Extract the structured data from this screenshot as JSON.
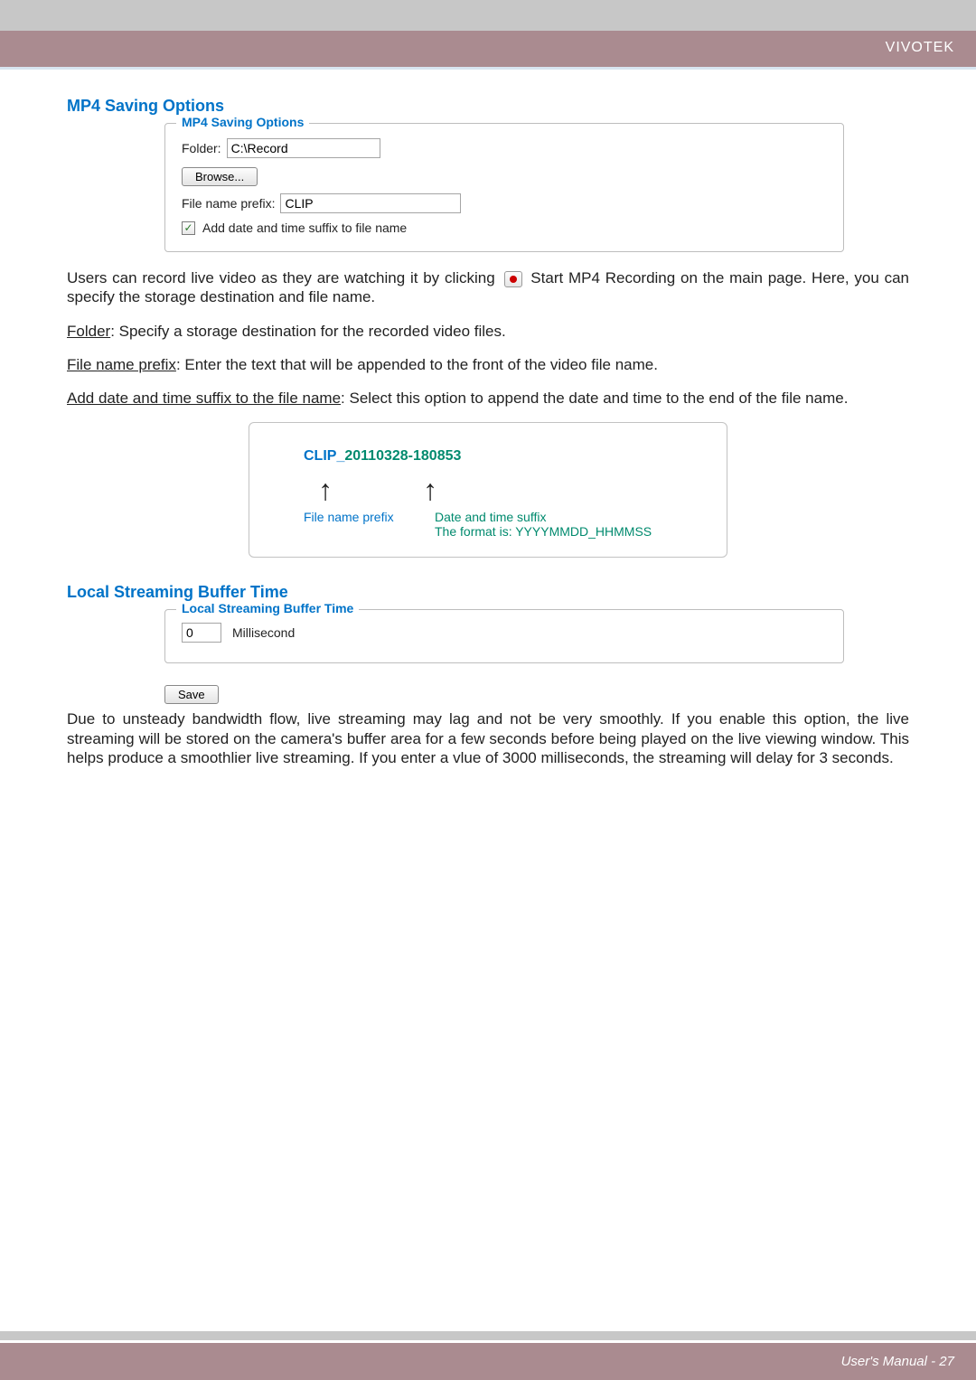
{
  "header": {
    "brand": "VIVOTEK"
  },
  "section1": {
    "title": "MP4 Saving Options",
    "legend": "MP4 Saving Options",
    "folder_label": "Folder:",
    "folder_value": "C:\\Record",
    "browse_label": "Browse...",
    "prefix_label": "File name prefix:",
    "prefix_value": "CLIP",
    "suffix_checkbox_label": "Add date and time suffix to file name"
  },
  "para1a": "Users can record live video as they are watching it by clicking ",
  "para1b": " Start MP4 Recording on the main page. Here, you can specify the storage destination and file name.",
  "para2_u": "Folder",
  "para2": ": Specify a storage destination for the recorded video files.",
  "para3_u": "File name prefix",
  "para3": ": Enter the text that will be appended to the front of the video file name.",
  "para4_u": "Add date and time suffix to the file name",
  "para4": ": Select this option to append the date and time to the end of the file name.",
  "example": {
    "prefix": "CLIP",
    "underscore": "_",
    "suffix": "20110328-180853",
    "label_prefix": "File name prefix",
    "label_suffix_line1": "Date and time suffix",
    "label_suffix_line2": "The format is: YYYYMMDD_HHMMSS"
  },
  "section2": {
    "title": "Local Streaming Buffer Time",
    "legend": "Local Streaming Buffer Time",
    "value": "0",
    "unit": "Millisecond",
    "save_label": "Save"
  },
  "para5": "Due to unsteady bandwidth flow, live streaming may lag and not be very smoothly. If you enable this option, the live streaming will be stored on the camera's buffer area for a few seconds before being played on the live viewing window. This helps produce a smoothlier live streaming. If you enter a vlue of 3000 milliseconds, the streaming will delay for 3 seconds.",
  "footer": {
    "text": "User's Manual - 27"
  }
}
